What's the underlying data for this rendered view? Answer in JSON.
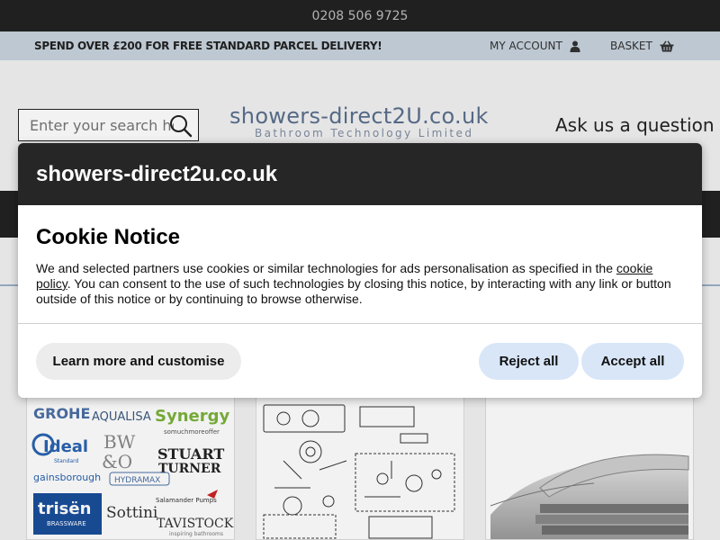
{
  "topbar": {
    "phone": "0208 506 9725"
  },
  "infobar": {
    "promo": "SPEND OVER £200 FOR FREE STANDARD PARCEL DELIVERY!",
    "account_label": "MY ACCOUNT",
    "basket_label": "BASKET"
  },
  "header": {
    "search_placeholder": "Enter your search here",
    "logo_main": "showers-direct2U.co.uk",
    "logo_sub": "Bathroom Technology Limited",
    "ask_label": "Ask us a question"
  },
  "brands": {
    "grohe": "GROHE",
    "aqualisa": "AQUALISA",
    "synergy": "Synergy",
    "synergy_sub": "somuchmoreoffer",
    "ideal": "Ideal",
    "ideal_sub": "Standard",
    "bw": "BW",
    "bw2": "&O",
    "stuart": "STUART",
    "turner": "TURNER",
    "gainsborough": "gainsborough",
    "hydramax": "HYDRAMAX",
    "trisen": "trisën",
    "trisen_sub": "BRASSWARE",
    "sottini": "Sottini",
    "salamander": "Salamander Pumps",
    "tavistock": "TAVISTOCK",
    "tavistock_sub": "inspiring bathrooms"
  },
  "modal": {
    "site_title": "showers-direct2u.co.uk",
    "heading": "Cookie Notice",
    "text_before_link": "We and selected partners use cookies or similar technologies for ads personalisation as specified in the ",
    "link_text": "cookie policy",
    "text_after_link": ". You can consent to the use of such technologies by closing this notice, by interacting with any link or button outside of this notice or by continuing to browse otherwise.",
    "learn_button": "Learn more and customise",
    "reject_button": "Reject all",
    "accept_button": "Accept all"
  },
  "colors": {
    "topbar_bg": "#222222",
    "infobar_bg": "#c8d3de",
    "modal_head_bg": "#262626",
    "button_blue": "#d8e6f8",
    "button_grey": "#ececec"
  },
  "icons": {
    "account": "user-icon",
    "basket": "basket-icon",
    "search": "search-icon"
  }
}
